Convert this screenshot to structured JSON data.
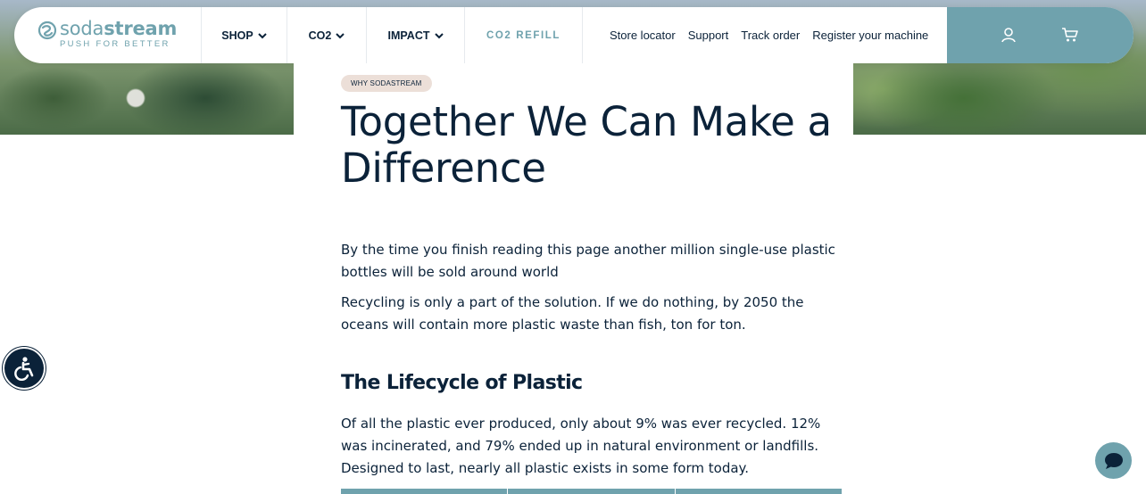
{
  "logo": {
    "name_light": "soda",
    "name_bold": "stream",
    "tagline": "PUSH FOR BETTER"
  },
  "nav": {
    "items": [
      {
        "label": "SHOP"
      },
      {
        "label": "CO2"
      },
      {
        "label": "IMPACT"
      },
      {
        "label": "CO2 REFILL"
      }
    ],
    "utility_links": [
      "Store locator",
      "Support",
      "Track order",
      "Register your machine"
    ],
    "icons": [
      "account-icon",
      "cart-icon"
    ]
  },
  "content": {
    "badge": "WHY SODASTREAM",
    "title": "Together We Can Make a Difference",
    "paragraph_1": "By the time you finish reading this page another million single-use plastic bottles will be sold around world",
    "paragraph_2": "Recycling is only a part of the solution. If we do nothing, by 2050 the oceans will contain more plastic waste than fish, ton for ton.",
    "section_heading": "The Lifecycle of Plastic",
    "paragraph_3": "Of all the plastic ever produced, only about 9% was ever recycled. 12% was incinerated, and 79% ended up in natural environment or landfills. Designed to last, nearly all plastic exists in some form today."
  },
  "widgets": {
    "accessibility": "accessibility-icon",
    "chat": "chat-bubble-icon"
  },
  "colors": {
    "brand_teal": "#6fa2ad",
    "navy": "#0b2239",
    "badge_bg": "#ecdfd8"
  }
}
